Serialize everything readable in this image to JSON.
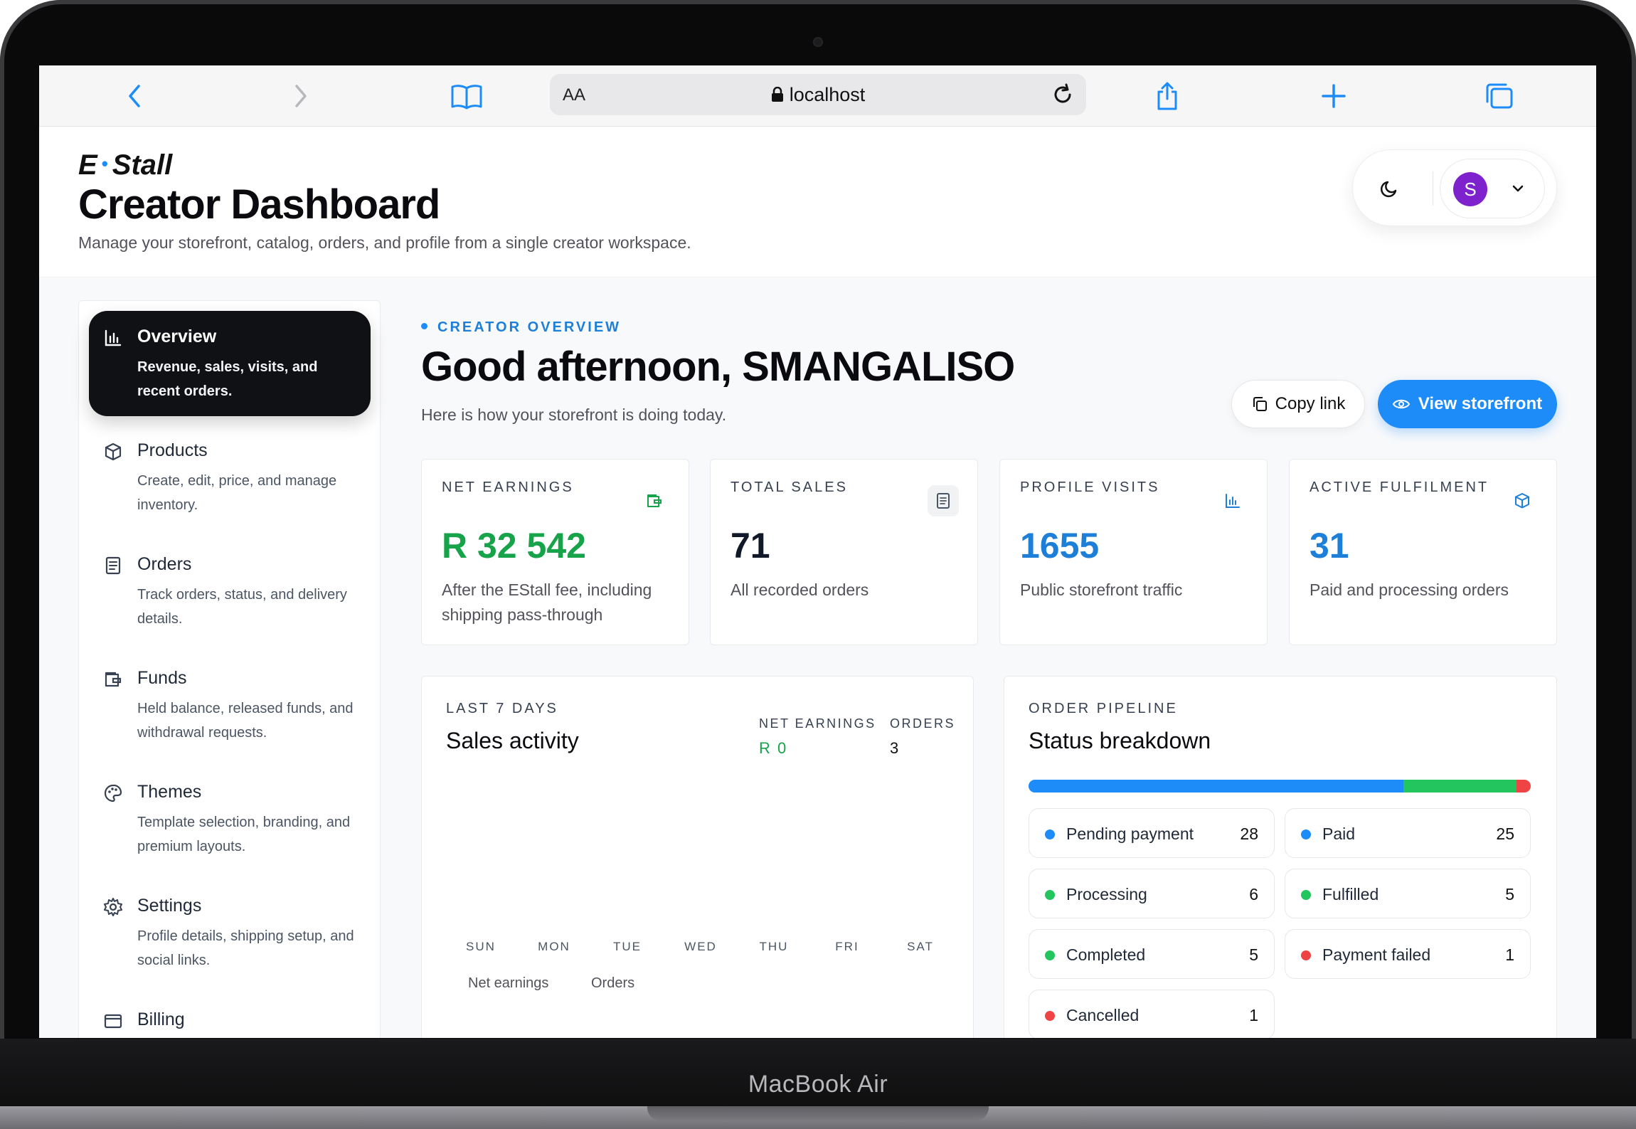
{
  "device": {
    "model_label": "MacBook Air"
  },
  "browser": {
    "text_size": "AA",
    "url": "localhost"
  },
  "app": {
    "brand_left": "E",
    "brand_dot": "•",
    "brand_right": "Stall",
    "title": "Creator Dashboard",
    "subtitle": "Manage your storefront, catalog, orders, and profile from a single creator workspace.",
    "user_initial": "S"
  },
  "sidebar": {
    "items": [
      {
        "label": "Overview",
        "desc": "Revenue, sales, visits, and recent orders.",
        "icon": "bar-chart-icon",
        "active": true
      },
      {
        "label": "Products",
        "desc": "Create, edit, price, and manage inventory.",
        "icon": "box-icon"
      },
      {
        "label": "Orders",
        "desc": "Track orders, status, and delivery details.",
        "icon": "document-icon"
      },
      {
        "label": "Funds",
        "desc": "Held balance, released funds, and withdrawal requests.",
        "icon": "wallet-icon"
      },
      {
        "label": "Themes",
        "desc": "Template selection, branding, and premium layouts.",
        "icon": "palette-icon"
      },
      {
        "label": "Settings",
        "desc": "Profile details, shipping setup, and social links.",
        "icon": "gear-icon"
      },
      {
        "label": "Billing",
        "desc": "",
        "icon": "credit-card-icon"
      }
    ]
  },
  "overview": {
    "kicker": "CREATOR OVERVIEW",
    "greeting": "Good afternoon, SMANGALISO",
    "subtitle": "Here is how your storefront is doing today.",
    "copy_link_label": "Copy link",
    "view_storefront_label": "View storefront"
  },
  "stats": [
    {
      "title": "NET EARNINGS",
      "value": "R 32 542",
      "desc": "After the EStall fee, including shipping pass-through",
      "color": "#16a34a",
      "icon": "wallet-icon"
    },
    {
      "title": "TOTAL SALES",
      "value": "71",
      "desc": "All recorded orders",
      "color": "#111827",
      "icon": "receipt-icon"
    },
    {
      "title": "PROFILE VISITS",
      "value": "1655",
      "desc": "Public storefront traffic",
      "color": "#1d7fd8",
      "icon": "bar-chart-icon"
    },
    {
      "title": "ACTIVE FULFILMENT",
      "value": "31",
      "desc": "Paid and processing orders",
      "color": "#1d7fd8",
      "icon": "box-icon"
    }
  ],
  "sales_activity": {
    "kicker": "LAST 7 DAYS",
    "title": "Sales activity",
    "net_earnings_label": "NET EARNINGS",
    "net_earnings_value": "R 0",
    "orders_label": "ORDERS",
    "orders_value": "3",
    "days": [
      "SUN",
      "MON",
      "TUE",
      "WED",
      "THU",
      "FRI",
      "SAT"
    ],
    "legend": [
      "Net earnings",
      "Orders"
    ]
  },
  "pipeline": {
    "kicker": "ORDER PIPELINE",
    "title": "Status breakdown",
    "bar_segments": [
      {
        "color": "#1d8cf8",
        "share": 0.746
      },
      {
        "color": "#22c55e",
        "share": 0.225
      },
      {
        "color": "#ef4444",
        "share": 0.029
      }
    ],
    "statuses": [
      {
        "label": "Pending payment",
        "count": "28",
        "color": "#1d8cf8"
      },
      {
        "label": "Paid",
        "count": "25",
        "color": "#1d8cf8"
      },
      {
        "label": "Processing",
        "count": "6",
        "color": "#22c55e"
      },
      {
        "label": "Fulfilled",
        "count": "5",
        "color": "#22c55e"
      },
      {
        "label": "Completed",
        "count": "5",
        "color": "#22c55e"
      },
      {
        "label": "Payment failed",
        "count": "1",
        "color": "#ef4444"
      },
      {
        "label": "Cancelled",
        "count": "1",
        "color": "#ef4444"
      }
    ]
  },
  "colors": {
    "accent": "#1d8cf8",
    "success": "#16a34a",
    "danger": "#ef4444",
    "dark": "#0f1115"
  }
}
